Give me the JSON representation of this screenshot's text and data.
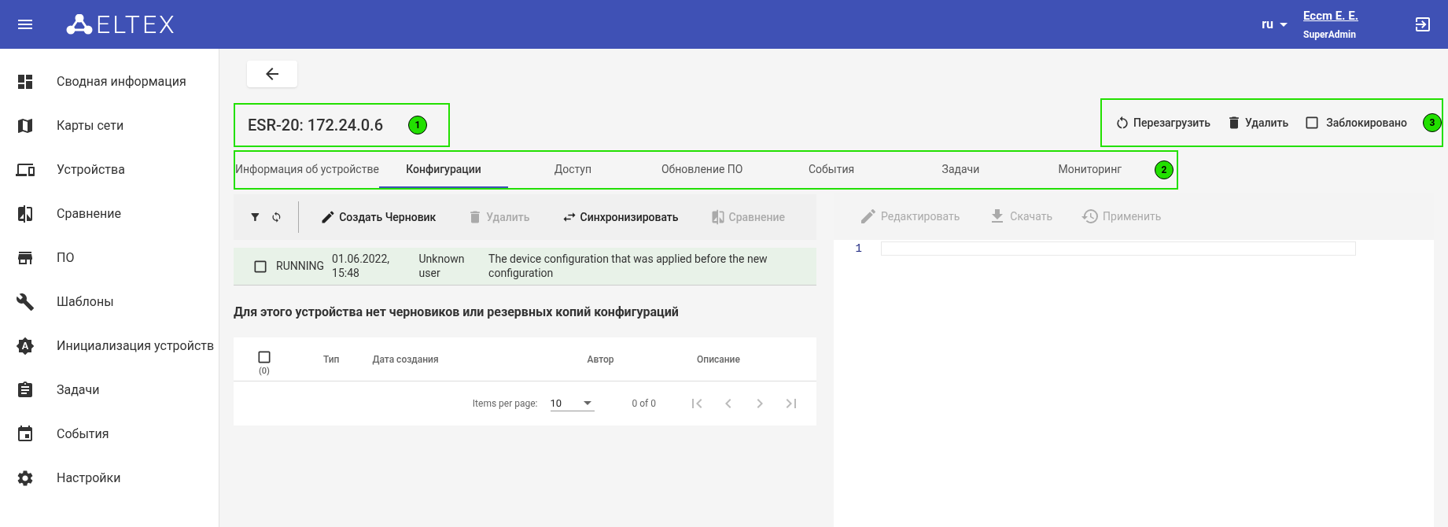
{
  "header": {
    "logo_text": "ELTEX",
    "language": "ru",
    "user_name": "Eccm E. E.",
    "user_role": "SuperAdmin"
  },
  "sidebar": {
    "items": [
      {
        "label": "Сводная информация"
      },
      {
        "label": "Карты сети"
      },
      {
        "label": "Устройства"
      },
      {
        "label": "Сравнение"
      },
      {
        "label": "ПО"
      },
      {
        "label": "Шаблоны"
      },
      {
        "label": "Инициализация устройств"
      },
      {
        "label": "Задачи"
      },
      {
        "label": "События"
      },
      {
        "label": "Настройки"
      }
    ]
  },
  "device": {
    "title": "ESR-20: 172.24.0.6",
    "callout": "1"
  },
  "actions": {
    "callout": "3",
    "items": [
      {
        "kind": "button",
        "label": "Перезагрузить"
      },
      {
        "kind": "button",
        "label": "Удалить"
      },
      {
        "kind": "checkbox",
        "label": "Заблокировано",
        "checked": false
      }
    ]
  },
  "tabs": {
    "callout": "2",
    "items": [
      {
        "label": "Информация об устройстве",
        "selected": false
      },
      {
        "label": "Конфигурации",
        "selected": true
      },
      {
        "label": "Доступ",
        "selected": false
      },
      {
        "label": "Обновление ПО",
        "selected": false
      },
      {
        "label": "События",
        "selected": false
      },
      {
        "label": "Задачи",
        "selected": false
      },
      {
        "label": "Мониторинг",
        "selected": false
      }
    ]
  },
  "left_toolbar": {
    "buttons": [
      {
        "label": "Создать Черновик",
        "disabled": false
      },
      {
        "label": "Удалить",
        "disabled": true
      },
      {
        "label": "Синхронизировать",
        "disabled": false
      },
      {
        "label": "Сравнение",
        "disabled": true
      }
    ]
  },
  "running_config": {
    "checked": false,
    "type": "RUNNING",
    "date": "01.06.2022, 15:48",
    "author": "Unknown user",
    "description": "The device configuration that was applied before the new configuration"
  },
  "empty_message": "Для этого устройства нет черновиков или резервных копий конфигураций",
  "table": {
    "select_all_checked": false,
    "selected_count": "(0)",
    "columns": [
      "Тип",
      "Дата создания",
      "Автор",
      "Описание"
    ],
    "paginator": {
      "items_per_page_label": "Items per page:",
      "page_size": "10",
      "range": "0 of 0"
    }
  },
  "right_toolbar": {
    "buttons": [
      {
        "label": "Редактировать",
        "disabled": true
      },
      {
        "label": "Скачать",
        "disabled": true
      },
      {
        "label": "Применить",
        "disabled": true
      }
    ]
  },
  "editor": {
    "line_numbers": [
      "1"
    ]
  }
}
